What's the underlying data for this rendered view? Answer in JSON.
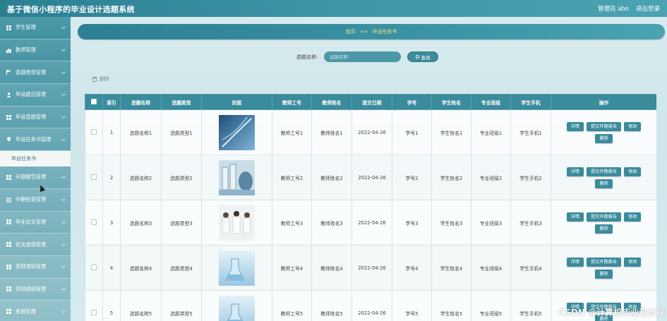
{
  "header": {
    "title": "基于微信小程序的毕业设计选题系统",
    "user": "管理员 abo",
    "logout": "退出登录"
  },
  "sidebar": {
    "items": [
      {
        "label": "学生管理",
        "icon": "grid-icon"
      },
      {
        "label": "教师管理",
        "icon": "chart-icon"
      },
      {
        "label": "选题类型管理",
        "icon": "flag-icon"
      },
      {
        "label": "毕设题目管理",
        "icon": "user-icon"
      },
      {
        "label": "毕设选题管理",
        "icon": "grid-icon"
      },
      {
        "label": "毕设任务书管理",
        "icon": "pin-icon"
      }
    ],
    "subitem": "毕设任务书",
    "items_after": [
      {
        "label": "开题报告管理",
        "icon": "grid-icon"
      },
      {
        "label": "中期检查管理",
        "icon": "list-icon"
      },
      {
        "label": "毕业论文管理",
        "icon": "grid-icon"
      },
      {
        "label": "论文成绩管理",
        "icon": "grid-icon"
      },
      {
        "label": "答辩通知管理",
        "icon": "grid-icon"
      },
      {
        "label": "答辩成绩管理",
        "icon": "grid-icon"
      },
      {
        "label": "系统管理",
        "icon": "grid-icon"
      }
    ]
  },
  "breadcrumb": {
    "home": "首页",
    "separator": ">>",
    "current": "毕设任务书"
  },
  "search": {
    "label": "选题名称:",
    "placeholder": "选题名称",
    "button": "查询"
  },
  "toolbar": {
    "delete_label": "删除"
  },
  "table": {
    "headers": [
      "",
      "索引",
      "选题名称",
      "选题类型",
      "封面",
      "教师工号",
      "教师姓名",
      "提交日期",
      "学号",
      "学生姓名",
      "专业班级",
      "学生手机",
      "操作"
    ],
    "rows": [
      {
        "index": "1",
        "topic": "选题名称1",
        "type": "选题类型1",
        "cover": "dna",
        "teacher_id": "教师工号1",
        "teacher_name": "教师姓名1",
        "date": "2022-04-26",
        "student_id": "学号1",
        "student_name": "学生姓名1",
        "class": "专业班级1",
        "phone": "学生手机1"
      },
      {
        "index": "2",
        "topic": "选题名称2",
        "type": "选题类型2",
        "cover": "lab",
        "teacher_id": "教师工号2",
        "teacher_name": "教师姓名2",
        "date": "2022-04-26",
        "student_id": "学号2",
        "student_name": "学生姓名2",
        "class": "专业班级2",
        "phone": "学生手机2"
      },
      {
        "index": "3",
        "topic": "选题名称3",
        "type": "选题类型3",
        "cover": "team",
        "teacher_id": "教师工号3",
        "teacher_name": "教师姓名3",
        "date": "2022-04-26",
        "student_id": "学号3",
        "student_name": "学生姓名3",
        "class": "专业班级3",
        "phone": "学生手机3"
      },
      {
        "index": "4",
        "topic": "选题名称4",
        "type": "选题类型4",
        "cover": "flask",
        "teacher_id": "教师工号4",
        "teacher_name": "教师姓名4",
        "date": "2022-04-26",
        "student_id": "学号4",
        "student_name": "学生姓名4",
        "class": "专业班级4",
        "phone": "学生手机4"
      },
      {
        "index": "5",
        "topic": "选题名称5",
        "type": "选题类型5",
        "cover": "flask",
        "teacher_id": "教师工号5",
        "teacher_name": "教师姓名5",
        "date": "2022-04-26",
        "student_id": "学号5",
        "student_name": "学生姓名5",
        "class": "专业班级5",
        "phone": "学生手机5"
      }
    ],
    "actions": [
      "详情",
      "提交开题报告",
      "修改",
      "删除"
    ]
  },
  "watermark": "CSDN @计算机毕业设计程",
  "colors": {
    "accent": "#3a8b9c",
    "breadcrumb_text": "#f5e27c"
  }
}
